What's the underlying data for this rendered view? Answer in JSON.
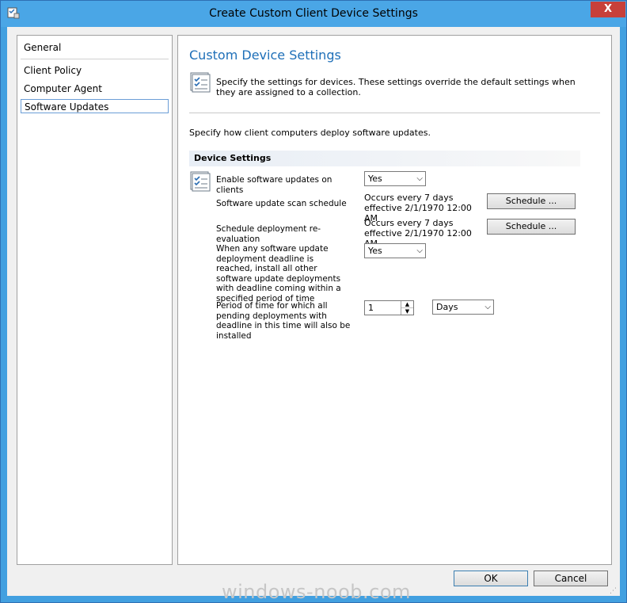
{
  "window": {
    "title": "Create Custom Client Device Settings",
    "close_symbol": "X"
  },
  "nav": {
    "items": [
      {
        "label": "General"
      },
      {
        "label": "Client Policy"
      },
      {
        "label": "Computer Agent"
      },
      {
        "label": "Software Updates"
      }
    ]
  },
  "main": {
    "heading": "Custom Device Settings",
    "description": "Specify the settings for devices. These settings override the default settings when they are assigned to a collection.",
    "specify_text": "Specify how client computers deploy software updates.",
    "section_title": "Device Settings",
    "settings": {
      "enable_label": "Enable software updates on clients",
      "enable_value": "Yes",
      "scan_label": "Software update scan schedule",
      "scan_occurs": "Occurs every 7 days effective 2/1/1970 12:00 AM",
      "scan_button": "Schedule ...",
      "reeval_label": "Schedule deployment re-evaluation",
      "reeval_occurs": "Occurs every 7 days effective 2/1/1970 12:00 AM",
      "reeval_button": "Schedule ...",
      "deadline_label": "When any software update deployment deadline is reached, install all other software update deployments with deadline coming within a specified period of time",
      "deadline_value": "Yes",
      "period_label": "Period of time for which all pending deployments with deadline in this time will also be installed",
      "period_value": "1",
      "period_unit": "Days"
    }
  },
  "footer": {
    "ok_label": "OK",
    "cancel_label": "Cancel"
  },
  "watermark": "windows-noob.com",
  "icons": {
    "app": "settings-sheet-icon",
    "header": "checklist-icon",
    "device": "checklist-icon",
    "dropdown": "chevron-down-icon"
  },
  "colors": {
    "titlebar": "#4aa6e6",
    "heading": "#1e6fb8",
    "close_button": "#c7403a"
  }
}
